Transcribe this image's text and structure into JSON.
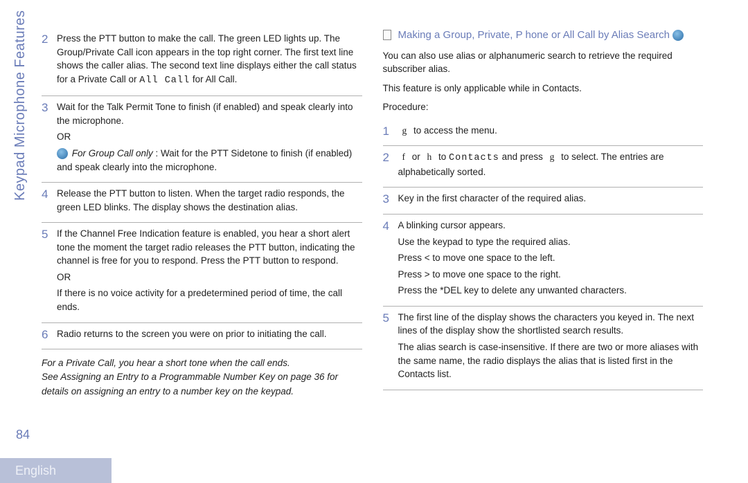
{
  "sideLabel": "Keypad Microphone Features",
  "pageNumber": "84",
  "english": "English",
  "leftCol": {
    "steps": [
      {
        "num": "2",
        "parts": [
          {
            "text": "Press the PTT button to make the call. The green LED lights up. The Group/Private Call icon appears in the top right corner. The first text line shows the caller alias. The second text line displays either the call status for a Private Call or "
          },
          {
            "text": "All Call",
            "mono": true
          },
          {
            "text": " for All Call."
          }
        ]
      },
      {
        "num": "3",
        "lines": [
          "Wait for the Talk Permit Tone to finish (if enabled) and speak clearly into the microphone.",
          "OR"
        ],
        "iconLine": {
          "italicPrefix": "For Group Call only",
          "rest": " : Wait for the PTT Sidetone to finish (if enabled) and speak clearly into the microphone."
        }
      },
      {
        "num": "4",
        "lines": [
          "Release the PTT button to listen. When the target radio responds, the green LED blinks. The display shows the destination alias."
        ]
      },
      {
        "num": "5",
        "lines": [
          "If the Channel Free Indication feature is enabled, you hear a short alert tone the moment the target radio releases the PTT button, indicating the channel is free for you to respond. Press the PTT button to respond.",
          "OR",
          "If there is no voice activity for a predetermined period of time, the call ends."
        ]
      },
      {
        "num": "6",
        "lines": [
          "Radio returns to the screen you were on prior to initiating the call."
        ]
      }
    ],
    "notes": [
      "For a Private Call, you hear a short tone when the call ends.",
      "See Assigning an Entry to a Programmable Number Key  on page 36 for details on assigning an entry to a number key on the keypad."
    ]
  },
  "rightCol": {
    "heading": "Making a Group, Private, P   hone or All Call by Alias Search",
    "intro": [
      "You can also use alias or alphanumeric search to retrieve the required subscriber alias.",
      "This feature is only applicable while in Contacts.",
      "Procedure:"
    ],
    "steps": [
      {
        "num": "1",
        "parts": [
          {
            "text": "g",
            "glyph": true
          },
          {
            "text": " to access the menu."
          }
        ]
      },
      {
        "num": "2",
        "parts": [
          {
            "text": "f",
            "glyph": true
          },
          {
            "text": " or "
          },
          {
            "text": "h",
            "glyph": true
          },
          {
            "text": " to "
          },
          {
            "text": "Contacts",
            "mono": true
          },
          {
            "text": " and press "
          },
          {
            "text": "g",
            "glyph": true
          },
          {
            "text": " to select. The entries are alphabetically sorted."
          }
        ]
      },
      {
        "num": "3",
        "lines": [
          "Key in the first character of the required alias."
        ]
      },
      {
        "num": "4",
        "lines": [
          "A blinking cursor appears.",
          "Use the keypad to type the required alias.",
          "Press < to move one space to the left.",
          "Press > to move one space to the right.",
          "Press the *DEL key to delete any unwanted characters."
        ]
      },
      {
        "num": "5",
        "lines": [
          "The first line of the display shows the characters you keyed in. The next lines of the display show the shortlisted search results.",
          "The alias search is case-insensitive. If there are two or more aliases with the same name, the radio displays the alias that is listed first in the Contacts list."
        ]
      }
    ]
  }
}
